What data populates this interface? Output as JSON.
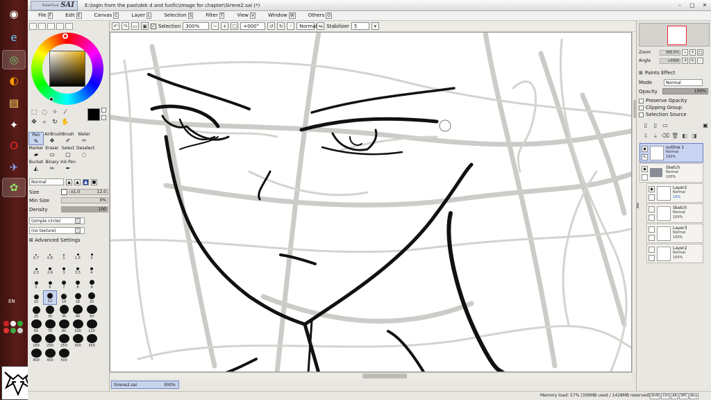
{
  "os": {
    "language_indicator": "EN"
  },
  "window": {
    "app_logo_small": "PaintTool",
    "app_logo": "SAI",
    "title": "E:\\login from the past\\dek d and funfic\\image for chapter\\Sirene2.sai (*)",
    "controls": [
      "–",
      "□",
      "✕"
    ]
  },
  "menu": [
    {
      "label": "File",
      "key": "F"
    },
    {
      "label": "Edit",
      "key": "E"
    },
    {
      "label": "Canvas",
      "key": "C"
    },
    {
      "label": "Layer",
      "key": "L"
    },
    {
      "label": "Selection",
      "key": "S"
    },
    {
      "label": "Filter",
      "key": "T"
    },
    {
      "label": "View",
      "key": "V"
    },
    {
      "label": "Window",
      "key": "W"
    },
    {
      "label": "Others",
      "key": "O"
    }
  ],
  "canvas_toolbar": {
    "selection_label": "Selection",
    "selection_checked": "✓",
    "zoom": "300%",
    "angle": "+000°",
    "blend_mode": "Normal",
    "stabilizer_label": "Stabilizer",
    "stabilizer_value": "5"
  },
  "tools": {
    "current_color": "#000000",
    "items": [
      {
        "label": "Pen",
        "icon": "✎",
        "active": true
      },
      {
        "label": "AirBrush",
        "icon": "✥",
        "active": false
      },
      {
        "label": "Brush",
        "icon": "✐",
        "active": false
      },
      {
        "label": "Water",
        "icon": "✑",
        "active": false
      },
      {
        "label": "",
        "icon": "",
        "active": false
      },
      {
        "label": "Marker",
        "icon": "▰",
        "active": false
      },
      {
        "label": "Eraser",
        "icon": "▭",
        "active": false
      },
      {
        "label": "Select",
        "icon": "▢",
        "active": false
      },
      {
        "label": "Deselect",
        "icon": "◌",
        "active": false
      },
      {
        "label": "",
        "icon": "",
        "active": false
      },
      {
        "label": "Bucket",
        "icon": "◭",
        "active": false
      },
      {
        "label": "Binary",
        "icon": "✏",
        "active": false
      },
      {
        "label": "Ink Pen",
        "icon": "✒",
        "active": false
      },
      {
        "label": "",
        "icon": "",
        "active": false
      },
      {
        "label": "",
        "icon": "",
        "active": false
      }
    ]
  },
  "tool_props": {
    "mode": "Normal",
    "size_label": "Size",
    "size_multiplier": "x1.0",
    "size_value": "12.0",
    "min_size_label": "Min Size",
    "min_size_value": "0%",
    "min_size_level": 0,
    "density_label": "Density",
    "density_value": "100",
    "density_level": 100,
    "shape": "(simple circle)",
    "texture": "(no texture)",
    "advanced_label": "Advanced Settings"
  },
  "brush_sizes": [
    "0.7",
    "0.8",
    "1",
    "1.5",
    "2",
    "2.3",
    "2.6",
    "3",
    "3.5",
    "4",
    "5",
    "6",
    "7",
    "8",
    "9",
    "10",
    "12",
    "14",
    "16",
    "20",
    "25",
    "30",
    "35",
    "40",
    "50",
    "60",
    "70",
    "80",
    "100",
    "120",
    "160",
    "200",
    "250",
    "300",
    "350",
    "400",
    "450",
    "500"
  ],
  "selected_brush_size": "12",
  "navigator": {
    "zoom_label": "Zoom",
    "zoom_value": "300.0%",
    "angle_label": "Angle",
    "angle_value": "+0000"
  },
  "layer_panel": {
    "paint_effects_label": "Paints Effect",
    "mode_label": "Mode",
    "mode_value": "Normal",
    "opacity_label": "Opacity",
    "opacity_value": "100%",
    "preserve_opacity": "Preserve Opacity",
    "clipping_group": "Clipping Group",
    "selection_source": "Selection Source",
    "layers": [
      {
        "name": "outline 1",
        "mode": "Normal",
        "opacity": "100%",
        "active": true,
        "folder": false,
        "indent": false,
        "visible": true
      },
      {
        "name": "Sketch",
        "mode": "Normal",
        "opacity": "100%",
        "active": false,
        "folder": true,
        "indent": false,
        "visible": true
      },
      {
        "name": "Layer2",
        "mode": "Normal",
        "opacity": "19%",
        "active": false,
        "folder": false,
        "indent": true,
        "visible": true
      },
      {
        "name": "Sketch",
        "mode": "Normal",
        "opacity": "100%",
        "active": false,
        "folder": false,
        "indent": true,
        "visible": false
      },
      {
        "name": "Layer3",
        "mode": "Normal",
        "opacity": "100%",
        "active": false,
        "folder": false,
        "indent": true,
        "visible": false
      },
      {
        "name": "Layer2",
        "mode": "Normal",
        "opacity": "100%",
        "active": false,
        "folder": false,
        "indent": true,
        "visible": false
      }
    ]
  },
  "document_tab": {
    "name": "Sirene2.sai",
    "zoom": "300%"
  },
  "status": {
    "memory": "Memory load: 57% (306MB used / 1428MB reserved)",
    "keys": [
      "Shift",
      "Ctrl",
      "Alt",
      "SPC",
      "Any"
    ]
  }
}
